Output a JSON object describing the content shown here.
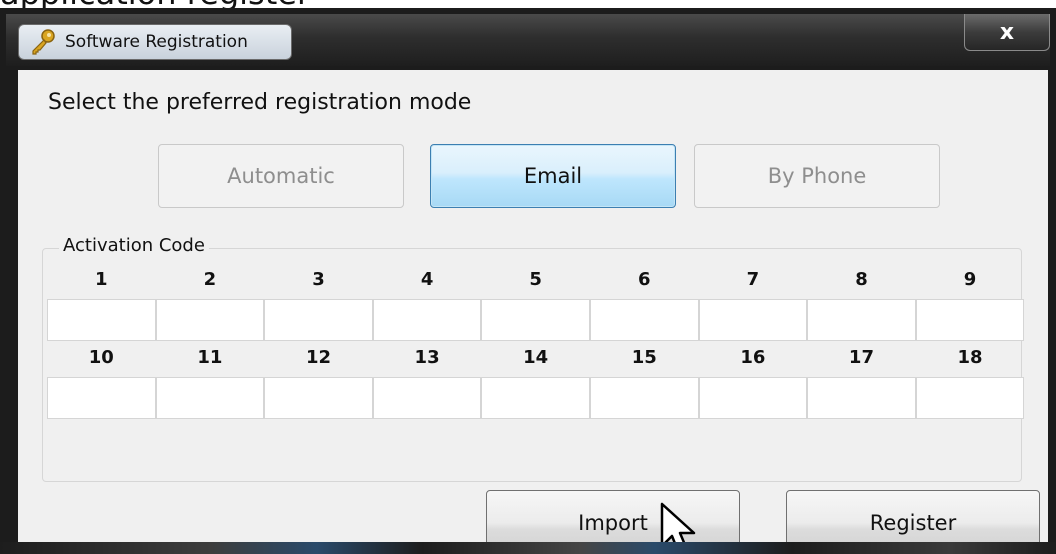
{
  "caption": "application register",
  "window": {
    "title": "Software Registration",
    "close_label": "x"
  },
  "instruction": "Select the preferred registration mode",
  "modes": [
    {
      "label": "Automatic",
      "state": "disabled"
    },
    {
      "label": "Email",
      "state": "selected"
    },
    {
      "label": "By Phone",
      "state": "disabled"
    }
  ],
  "activation": {
    "legend": "Activation Code",
    "row1_labels": [
      "1",
      "2",
      "3",
      "4",
      "5",
      "6",
      "7",
      "8",
      "9"
    ],
    "row2_labels": [
      "10",
      "11",
      "12",
      "13",
      "14",
      "15",
      "16",
      "17",
      "18"
    ],
    "values": [
      "",
      "",
      "",
      "",
      "",
      "",
      "",
      "",
      "",
      "",
      "",
      "",
      "",
      "",
      "",
      "",
      "",
      ""
    ]
  },
  "buttons": {
    "import_label": "Import",
    "register_label": "Register"
  },
  "colors": {
    "selected_border": "#3c7fb1",
    "disabled_text": "#8e8e8e",
    "client_bg": "#f0f0f0"
  }
}
